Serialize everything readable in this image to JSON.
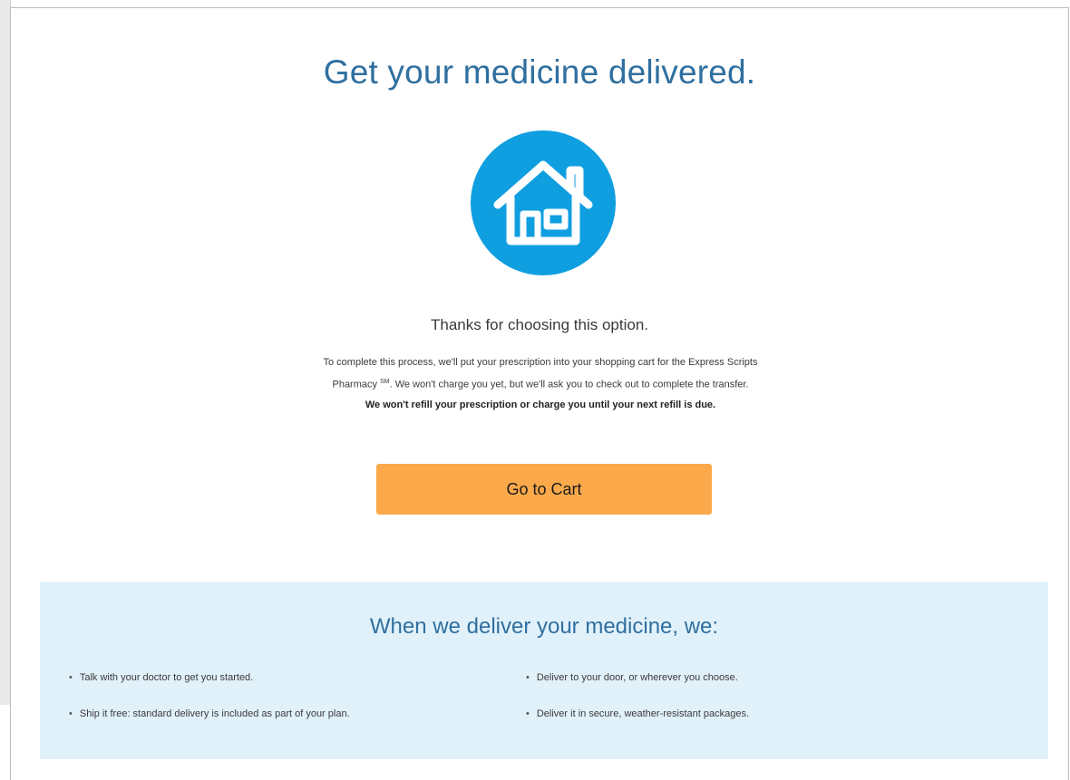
{
  "header": {
    "title": "Get your medicine delivered."
  },
  "icon": {
    "name": "house-icon",
    "circle_color": "#0f9ee0"
  },
  "message": {
    "thanks": "Thanks for choosing this option.",
    "line1": "To complete this process, we'll put your prescription into your shopping cart for the Express Scripts",
    "line2_start": "Pharmacy",
    "line2_sup": "SM",
    "line2_end": ". We won't charge you yet, but we'll ask you to check out to complete the transfer.",
    "line3_bold": "We won't refill your prescription or charge you until your next refill is due."
  },
  "cta": {
    "label": "Go to Cart",
    "color": "#fba94a"
  },
  "benefits": {
    "title": "When we deliver your medicine, we:",
    "background": "#e1f1fa",
    "items": [
      "Talk with your doctor to get you started.",
      "Ship it free: standard delivery is included as part of your plan.",
      "Deliver to your door, or wherever you choose.",
      "Deliver it in secure, weather-resistant packages."
    ]
  },
  "colors": {
    "heading": "#2f6f9f",
    "text": "#3a3a3a"
  }
}
